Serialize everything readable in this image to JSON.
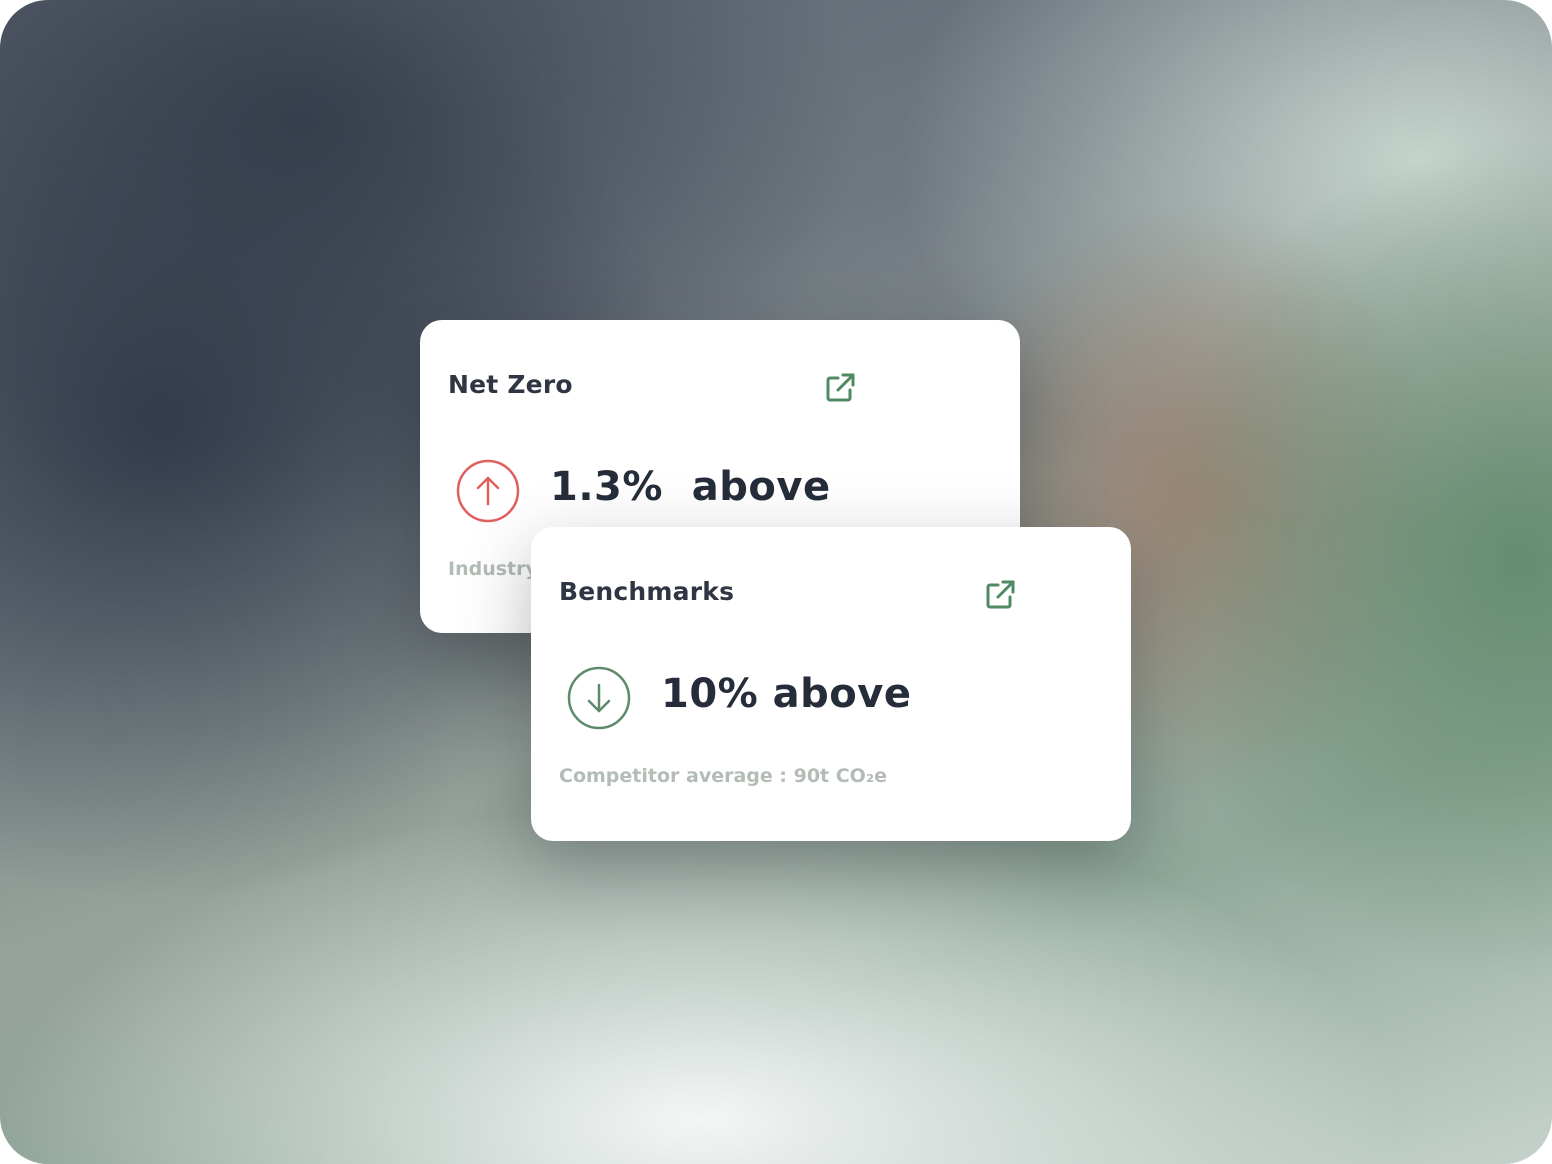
{
  "colors": {
    "increase": "#e0605e",
    "decrease": "#5e8a6c",
    "link_icon": "#4f8a63",
    "title_text": "#2f3542",
    "caption_text": "#b4bcb6"
  },
  "net_zero": {
    "title": "Net Zero",
    "link_icon": "external-link-icon",
    "trend_icon": "arrow-up-circle-icon",
    "value": "1.3%  above",
    "caption": "Industry"
  },
  "benchmarks": {
    "title": "Benchmarks",
    "link_icon": "external-link-icon",
    "trend_icon": "arrow-down-circle-icon",
    "value": "10% above",
    "caption": "Competitor average : 90t CO₂e"
  }
}
